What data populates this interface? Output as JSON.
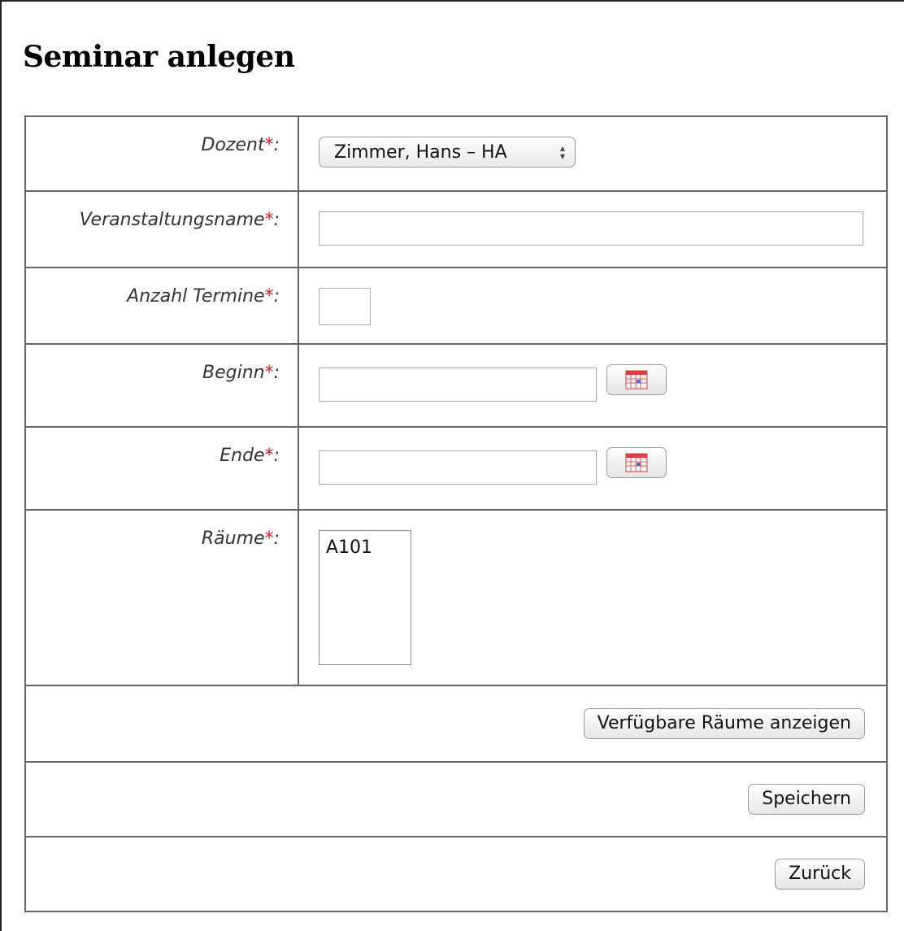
{
  "page_title": "Seminar anlegen",
  "required_marker": "*",
  "colors": {
    "required": "#cc2222",
    "border": "#666666"
  },
  "fields": {
    "dozent": {
      "label": "Dozent",
      "suffix": ":",
      "selected": "Zimmer, Hans – HA"
    },
    "veranstaltungsname": {
      "label": "Veranstaltungsname",
      "suffix": ":",
      "value": ""
    },
    "anzahl_termine": {
      "label": "Anzahl Termine",
      "suffix": ":",
      "value": ""
    },
    "beginn": {
      "label": "Beginn",
      "suffix": ":",
      "value": ""
    },
    "ende": {
      "label": "Ende",
      "suffix": ":",
      "value": ""
    },
    "raeume": {
      "label": "Räume",
      "suffix": ":",
      "options": [
        "A101"
      ]
    }
  },
  "buttons": {
    "show_rooms": "Verfügbare Räume anzeigen",
    "save": "Speichern",
    "back": "Zurück"
  },
  "icons": {
    "calendar": "calendar-icon",
    "select_arrows": "updown-arrows-icon"
  }
}
